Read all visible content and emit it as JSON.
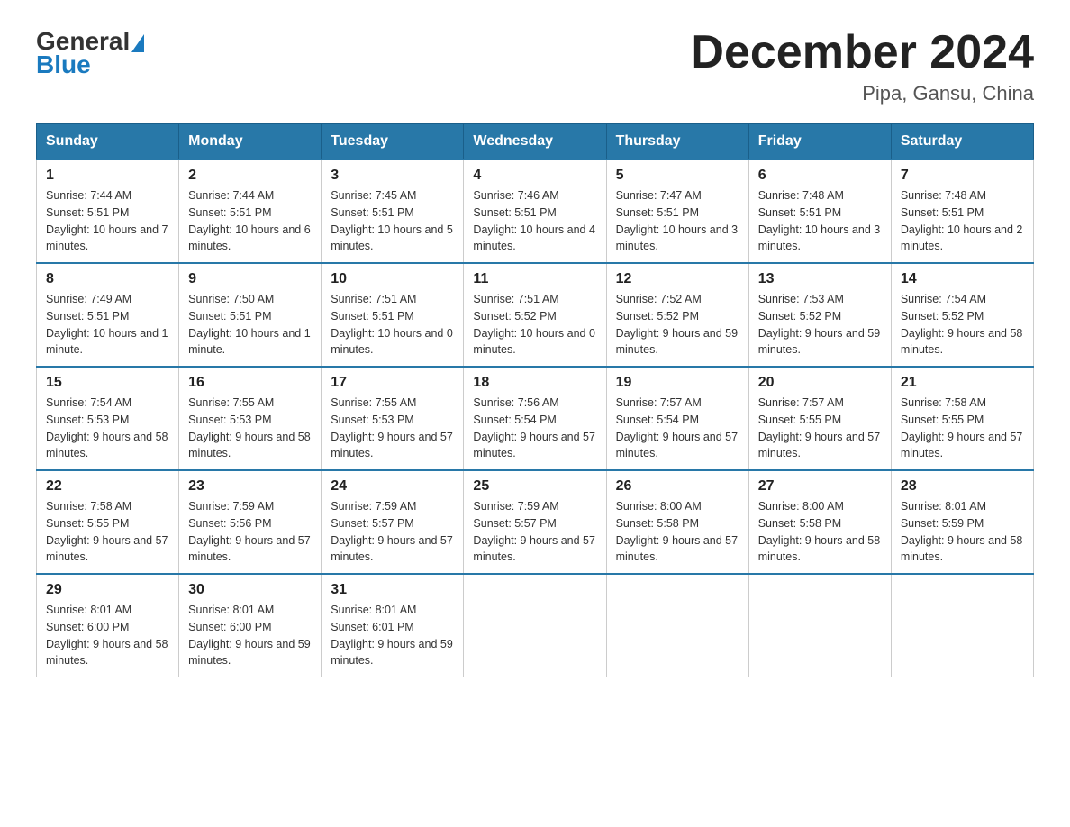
{
  "logo": {
    "text_general": "General",
    "text_blue": "Blue"
  },
  "title": "December 2024",
  "subtitle": "Pipa, Gansu, China",
  "days_of_week": [
    "Sunday",
    "Monday",
    "Tuesday",
    "Wednesday",
    "Thursday",
    "Friday",
    "Saturday"
  ],
  "weeks": [
    [
      {
        "day": "1",
        "sunrise": "7:44 AM",
        "sunset": "5:51 PM",
        "daylight": "10 hours and 7 minutes."
      },
      {
        "day": "2",
        "sunrise": "7:44 AM",
        "sunset": "5:51 PM",
        "daylight": "10 hours and 6 minutes."
      },
      {
        "day": "3",
        "sunrise": "7:45 AM",
        "sunset": "5:51 PM",
        "daylight": "10 hours and 5 minutes."
      },
      {
        "day": "4",
        "sunrise": "7:46 AM",
        "sunset": "5:51 PM",
        "daylight": "10 hours and 4 minutes."
      },
      {
        "day": "5",
        "sunrise": "7:47 AM",
        "sunset": "5:51 PM",
        "daylight": "10 hours and 3 minutes."
      },
      {
        "day": "6",
        "sunrise": "7:48 AM",
        "sunset": "5:51 PM",
        "daylight": "10 hours and 3 minutes."
      },
      {
        "day": "7",
        "sunrise": "7:48 AM",
        "sunset": "5:51 PM",
        "daylight": "10 hours and 2 minutes."
      }
    ],
    [
      {
        "day": "8",
        "sunrise": "7:49 AM",
        "sunset": "5:51 PM",
        "daylight": "10 hours and 1 minute."
      },
      {
        "day": "9",
        "sunrise": "7:50 AM",
        "sunset": "5:51 PM",
        "daylight": "10 hours and 1 minute."
      },
      {
        "day": "10",
        "sunrise": "7:51 AM",
        "sunset": "5:51 PM",
        "daylight": "10 hours and 0 minutes."
      },
      {
        "day": "11",
        "sunrise": "7:51 AM",
        "sunset": "5:52 PM",
        "daylight": "10 hours and 0 minutes."
      },
      {
        "day": "12",
        "sunrise": "7:52 AM",
        "sunset": "5:52 PM",
        "daylight": "9 hours and 59 minutes."
      },
      {
        "day": "13",
        "sunrise": "7:53 AM",
        "sunset": "5:52 PM",
        "daylight": "9 hours and 59 minutes."
      },
      {
        "day": "14",
        "sunrise": "7:54 AM",
        "sunset": "5:52 PM",
        "daylight": "9 hours and 58 minutes."
      }
    ],
    [
      {
        "day": "15",
        "sunrise": "7:54 AM",
        "sunset": "5:53 PM",
        "daylight": "9 hours and 58 minutes."
      },
      {
        "day": "16",
        "sunrise": "7:55 AM",
        "sunset": "5:53 PM",
        "daylight": "9 hours and 58 minutes."
      },
      {
        "day": "17",
        "sunrise": "7:55 AM",
        "sunset": "5:53 PM",
        "daylight": "9 hours and 57 minutes."
      },
      {
        "day": "18",
        "sunrise": "7:56 AM",
        "sunset": "5:54 PM",
        "daylight": "9 hours and 57 minutes."
      },
      {
        "day": "19",
        "sunrise": "7:57 AM",
        "sunset": "5:54 PM",
        "daylight": "9 hours and 57 minutes."
      },
      {
        "day": "20",
        "sunrise": "7:57 AM",
        "sunset": "5:55 PM",
        "daylight": "9 hours and 57 minutes."
      },
      {
        "day": "21",
        "sunrise": "7:58 AM",
        "sunset": "5:55 PM",
        "daylight": "9 hours and 57 minutes."
      }
    ],
    [
      {
        "day": "22",
        "sunrise": "7:58 AM",
        "sunset": "5:55 PM",
        "daylight": "9 hours and 57 minutes."
      },
      {
        "day": "23",
        "sunrise": "7:59 AM",
        "sunset": "5:56 PM",
        "daylight": "9 hours and 57 minutes."
      },
      {
        "day": "24",
        "sunrise": "7:59 AM",
        "sunset": "5:57 PM",
        "daylight": "9 hours and 57 minutes."
      },
      {
        "day": "25",
        "sunrise": "7:59 AM",
        "sunset": "5:57 PM",
        "daylight": "9 hours and 57 minutes."
      },
      {
        "day": "26",
        "sunrise": "8:00 AM",
        "sunset": "5:58 PM",
        "daylight": "9 hours and 57 minutes."
      },
      {
        "day": "27",
        "sunrise": "8:00 AM",
        "sunset": "5:58 PM",
        "daylight": "9 hours and 58 minutes."
      },
      {
        "day": "28",
        "sunrise": "8:01 AM",
        "sunset": "5:59 PM",
        "daylight": "9 hours and 58 minutes."
      }
    ],
    [
      {
        "day": "29",
        "sunrise": "8:01 AM",
        "sunset": "6:00 PM",
        "daylight": "9 hours and 58 minutes."
      },
      {
        "day": "30",
        "sunrise": "8:01 AM",
        "sunset": "6:00 PM",
        "daylight": "9 hours and 59 minutes."
      },
      {
        "day": "31",
        "sunrise": "8:01 AM",
        "sunset": "6:01 PM",
        "daylight": "9 hours and 59 minutes."
      },
      null,
      null,
      null,
      null
    ]
  ]
}
